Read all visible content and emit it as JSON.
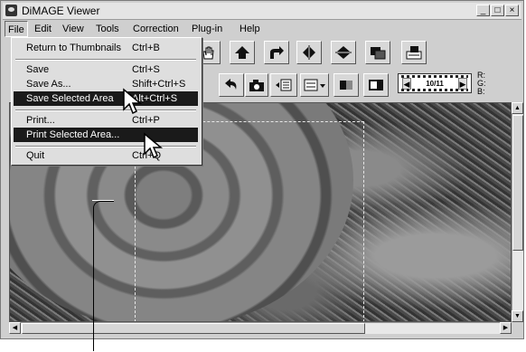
{
  "window": {
    "title": "DiMAGE Viewer"
  },
  "window_buttons": [
    "_",
    "□",
    "×"
  ],
  "menubar": {
    "items": [
      {
        "label": "File",
        "active": true
      },
      {
        "label": "Edit"
      },
      {
        "label": "View"
      },
      {
        "label": "Tools"
      },
      {
        "label": "Correction"
      },
      {
        "label": "Plug-in"
      },
      {
        "label": "Help"
      }
    ]
  },
  "file_menu": {
    "items": [
      {
        "label": "Return to Thumbnails",
        "shortcut": "Ctrl+B"
      },
      {
        "label": "Save",
        "shortcut": "Ctrl+S"
      },
      {
        "label": "Save As...",
        "shortcut": "Shift+Ctrl+S"
      },
      {
        "label": "Save Selected Area",
        "shortcut": "Alt+Ctrl+S",
        "highlighted": true
      },
      {
        "label": "Print...",
        "shortcut": "Ctrl+P"
      },
      {
        "label": "Print Selected Area...",
        "shortcut": "",
        "highlighted": true
      },
      {
        "label": "Quit",
        "shortcut": "Ctrl+Q"
      }
    ]
  },
  "frame_counter": {
    "text": "10/11",
    "prev": "◀",
    "next": "▶"
  },
  "color_readout": {
    "r": "R:",
    "g": "G:",
    "b": "B:"
  },
  "colors": {
    "menu_highlight": "#1a1a1a",
    "window_bg": "#cfcfcf"
  }
}
